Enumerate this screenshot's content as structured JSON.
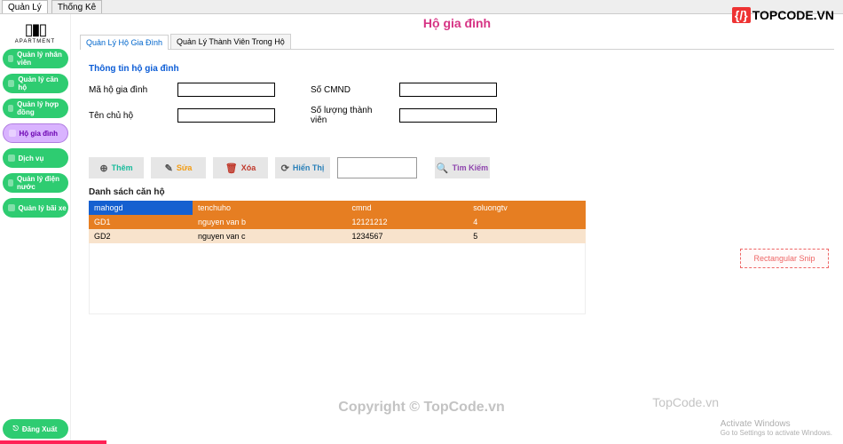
{
  "topbar": {
    "tabs": [
      "Quản Lý",
      "Thống Kê"
    ]
  },
  "logo": {
    "name": "APARTMENT"
  },
  "sidebar": {
    "items": [
      {
        "label": "Quản lý nhân viên"
      },
      {
        "label": "Quản lý căn hộ"
      },
      {
        "label": "Quản lý hợp đồng"
      },
      {
        "label": "Hộ gia đình"
      },
      {
        "label": "Dịch vụ"
      },
      {
        "label": "Quản lý điện nước"
      },
      {
        "label": "Quản lý bãi xe"
      }
    ],
    "logout": "Đăng Xuất"
  },
  "page": {
    "title": "Hộ gia đình",
    "subtabs": [
      "Quản Lý Hộ Gia Đình",
      "Quản Lý Thành Viên Trong Hộ"
    ]
  },
  "form": {
    "legend": "Thông tin hộ gia đình",
    "fields": {
      "mahogd_label": "Mã hộ gia đình",
      "mahogd_value": "",
      "cmnd_label": "Số CMND",
      "cmnd_value": "",
      "tenchuho_label": "Tên chủ hộ",
      "tenchuho_value": "",
      "soluong_label": "Số lượng thành viên",
      "soluong_value": ""
    }
  },
  "toolbar": {
    "add": "Thêm",
    "edit": "Sửa",
    "delete": "Xóa",
    "show": "Hiển Thị",
    "search_value": "",
    "search_btn": "Tìm Kiếm"
  },
  "table": {
    "caption": "Danh sách căn hộ",
    "headers": [
      "mahogd",
      "tenchuho",
      "cmnd",
      "soluongtv"
    ],
    "rows": [
      [
        "GD1",
        "nguyen van b",
        "12121212",
        "4"
      ],
      [
        "GD2",
        "nguyen van c",
        "1234567",
        "5"
      ]
    ]
  },
  "watermark": {
    "brand_prefix": "{",
    "brand_suffix": "}",
    "brand": "TOPCODE.VN",
    "center": "Copyright © TopCode.vn",
    "right": "TopCode.vn",
    "activate1": "Activate Windows",
    "activate2": "Go to Settings to activate Windows.",
    "snip": "Rectangular Snip"
  }
}
